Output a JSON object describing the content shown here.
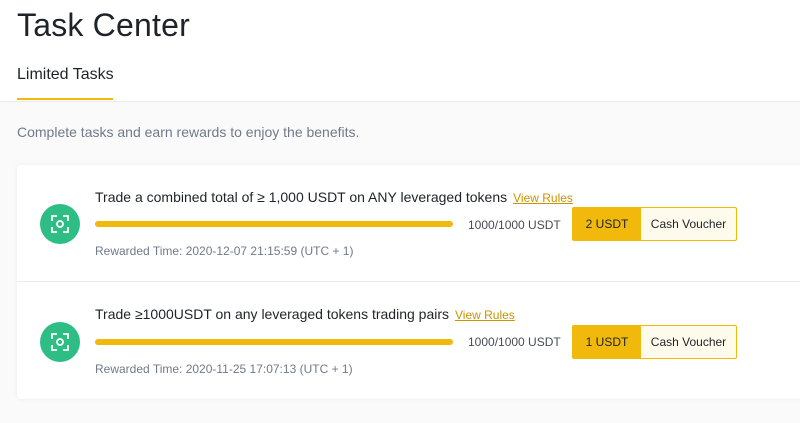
{
  "header": {
    "title": "Task Center",
    "tabs": [
      {
        "label": "Limited Tasks",
        "active": true
      }
    ]
  },
  "subtitle": "Complete tasks and earn rewards to enjoy the benefits.",
  "tasks": [
    {
      "title": "Trade a combined total of ≥ 1,000 USDT on ANY leveraged tokens",
      "view_rules": "View Rules",
      "progress_text": "1000/1000 USDT",
      "progress": 1.0,
      "reward_amount": "2 USDT",
      "reward_type": "Cash Voucher",
      "rewarded_time": "Rewarded Time: 2020-12-07 21:15:59 (UTC + 1)"
    },
    {
      "title": "Trade ≥1000USDT on any leveraged tokens trading pairs",
      "view_rules": "View Rules",
      "progress_text": "1000/1000 USDT",
      "progress": 1.0,
      "reward_amount": "1 USDT",
      "reward_type": "Cash Voucher",
      "rewarded_time": "Rewarded Time: 2020-11-25 17:07:13 (UTC + 1)"
    }
  ],
  "icons": {
    "task_icon": "task-scan-icon"
  },
  "colors": {
    "accent": "#f0b90b",
    "icon_bg": "#2ebd85",
    "link": "#c99400"
  }
}
